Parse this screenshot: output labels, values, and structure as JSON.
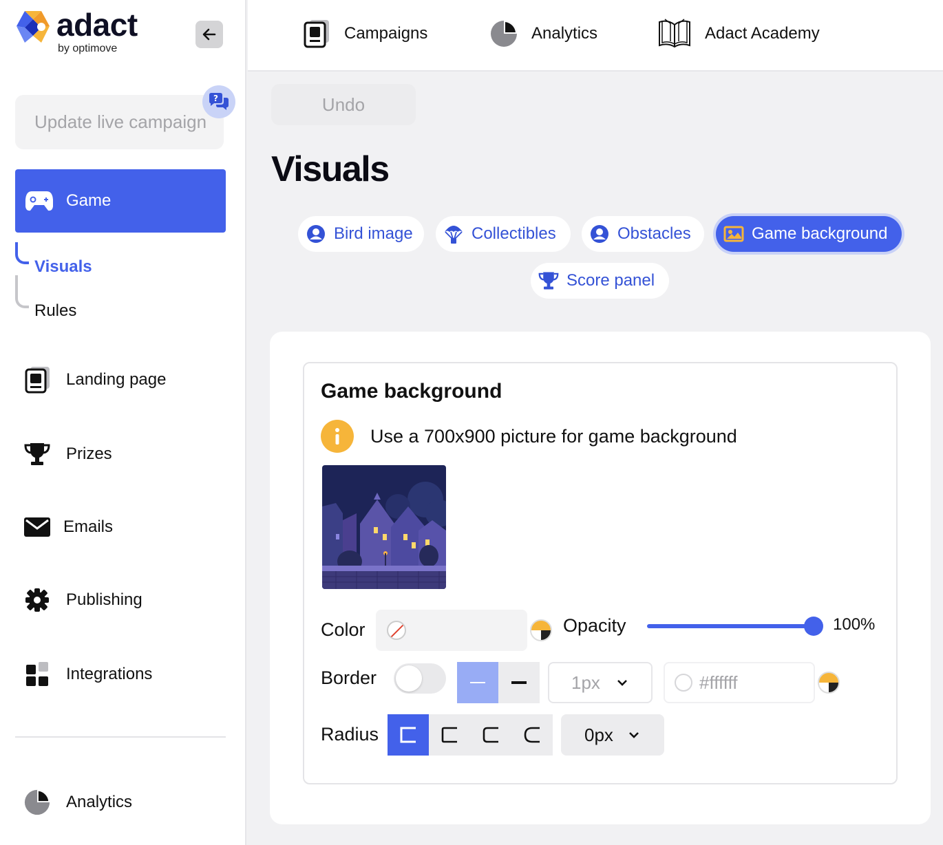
{
  "brand": {
    "name": "adact",
    "sub": "by optimove",
    "accent": "#4361ea",
    "warn": "#f6b53a"
  },
  "sidebar": {
    "update_label": "Update live campaign",
    "game_label": "Game",
    "sub": {
      "visuals": "Visuals",
      "rules": "Rules"
    },
    "items": [
      {
        "label": "Landing page",
        "icon": "landing-page-icon"
      },
      {
        "label": "Prizes",
        "icon": "trophy-icon"
      },
      {
        "label": "Emails",
        "icon": "envelope-icon"
      },
      {
        "label": "Publishing",
        "icon": "gear-icon"
      },
      {
        "label": "Integrations",
        "icon": "integrations-icon"
      }
    ],
    "bottom": {
      "label": "Analytics",
      "icon": "pie-chart-icon"
    }
  },
  "topbar": {
    "campaigns": "Campaigns",
    "analytics": "Analytics",
    "academy": "Adact Academy"
  },
  "main": {
    "undo": "Undo",
    "title": "Visuals",
    "tabs": [
      {
        "label": "Bird image"
      },
      {
        "label": "Collectibles"
      },
      {
        "label": "Obstacles"
      },
      {
        "label": "Game background"
      },
      {
        "label": "Score panel"
      }
    ],
    "active_tab": "Game background"
  },
  "panel": {
    "title": "Game background",
    "info": "Use a 700x900 picture for game background",
    "color_label": "Color",
    "opacity_label": "Opacity",
    "opacity_value": "100%",
    "opacity_fraction": 1.0,
    "border_label": "Border",
    "border_width": "1px",
    "border_color": "#ffffff",
    "radius_label": "Radius",
    "radius_value": "0px"
  }
}
